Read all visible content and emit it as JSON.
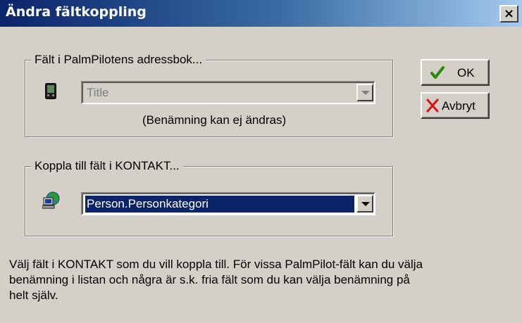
{
  "dialog": {
    "title": "Ändra fältkoppling",
    "close_label": "×"
  },
  "palm_group": {
    "legend": "Fält i PalmPilotens adressbok...",
    "field_value": "Title",
    "note": "(Benämning kan ej ändras)",
    "icon": "palm-device-icon"
  },
  "kontakt_group": {
    "legend": "Koppla till fält i KONTAKT...",
    "field_value": "Person.Personkategori",
    "icon": "computer-globe-icon"
  },
  "buttons": {
    "ok_label": "OK",
    "cancel_label": "Avbryt"
  },
  "help_text": "Välj fält i KONTAKT som du vill koppla till. För vissa PalmPilot-fält kan du välja\nbenämning i listan och några är s.k. fria fält som du kan välja benämning på\nhelt själv.",
  "colors": {
    "title_bar_start": "#0a246a",
    "title_bar_end": "#a6caf0",
    "dialog_face": "#d4d0c8",
    "selection": "#0a246a",
    "ok_check": "#2a8a0a",
    "cancel_x": "#e01010"
  }
}
